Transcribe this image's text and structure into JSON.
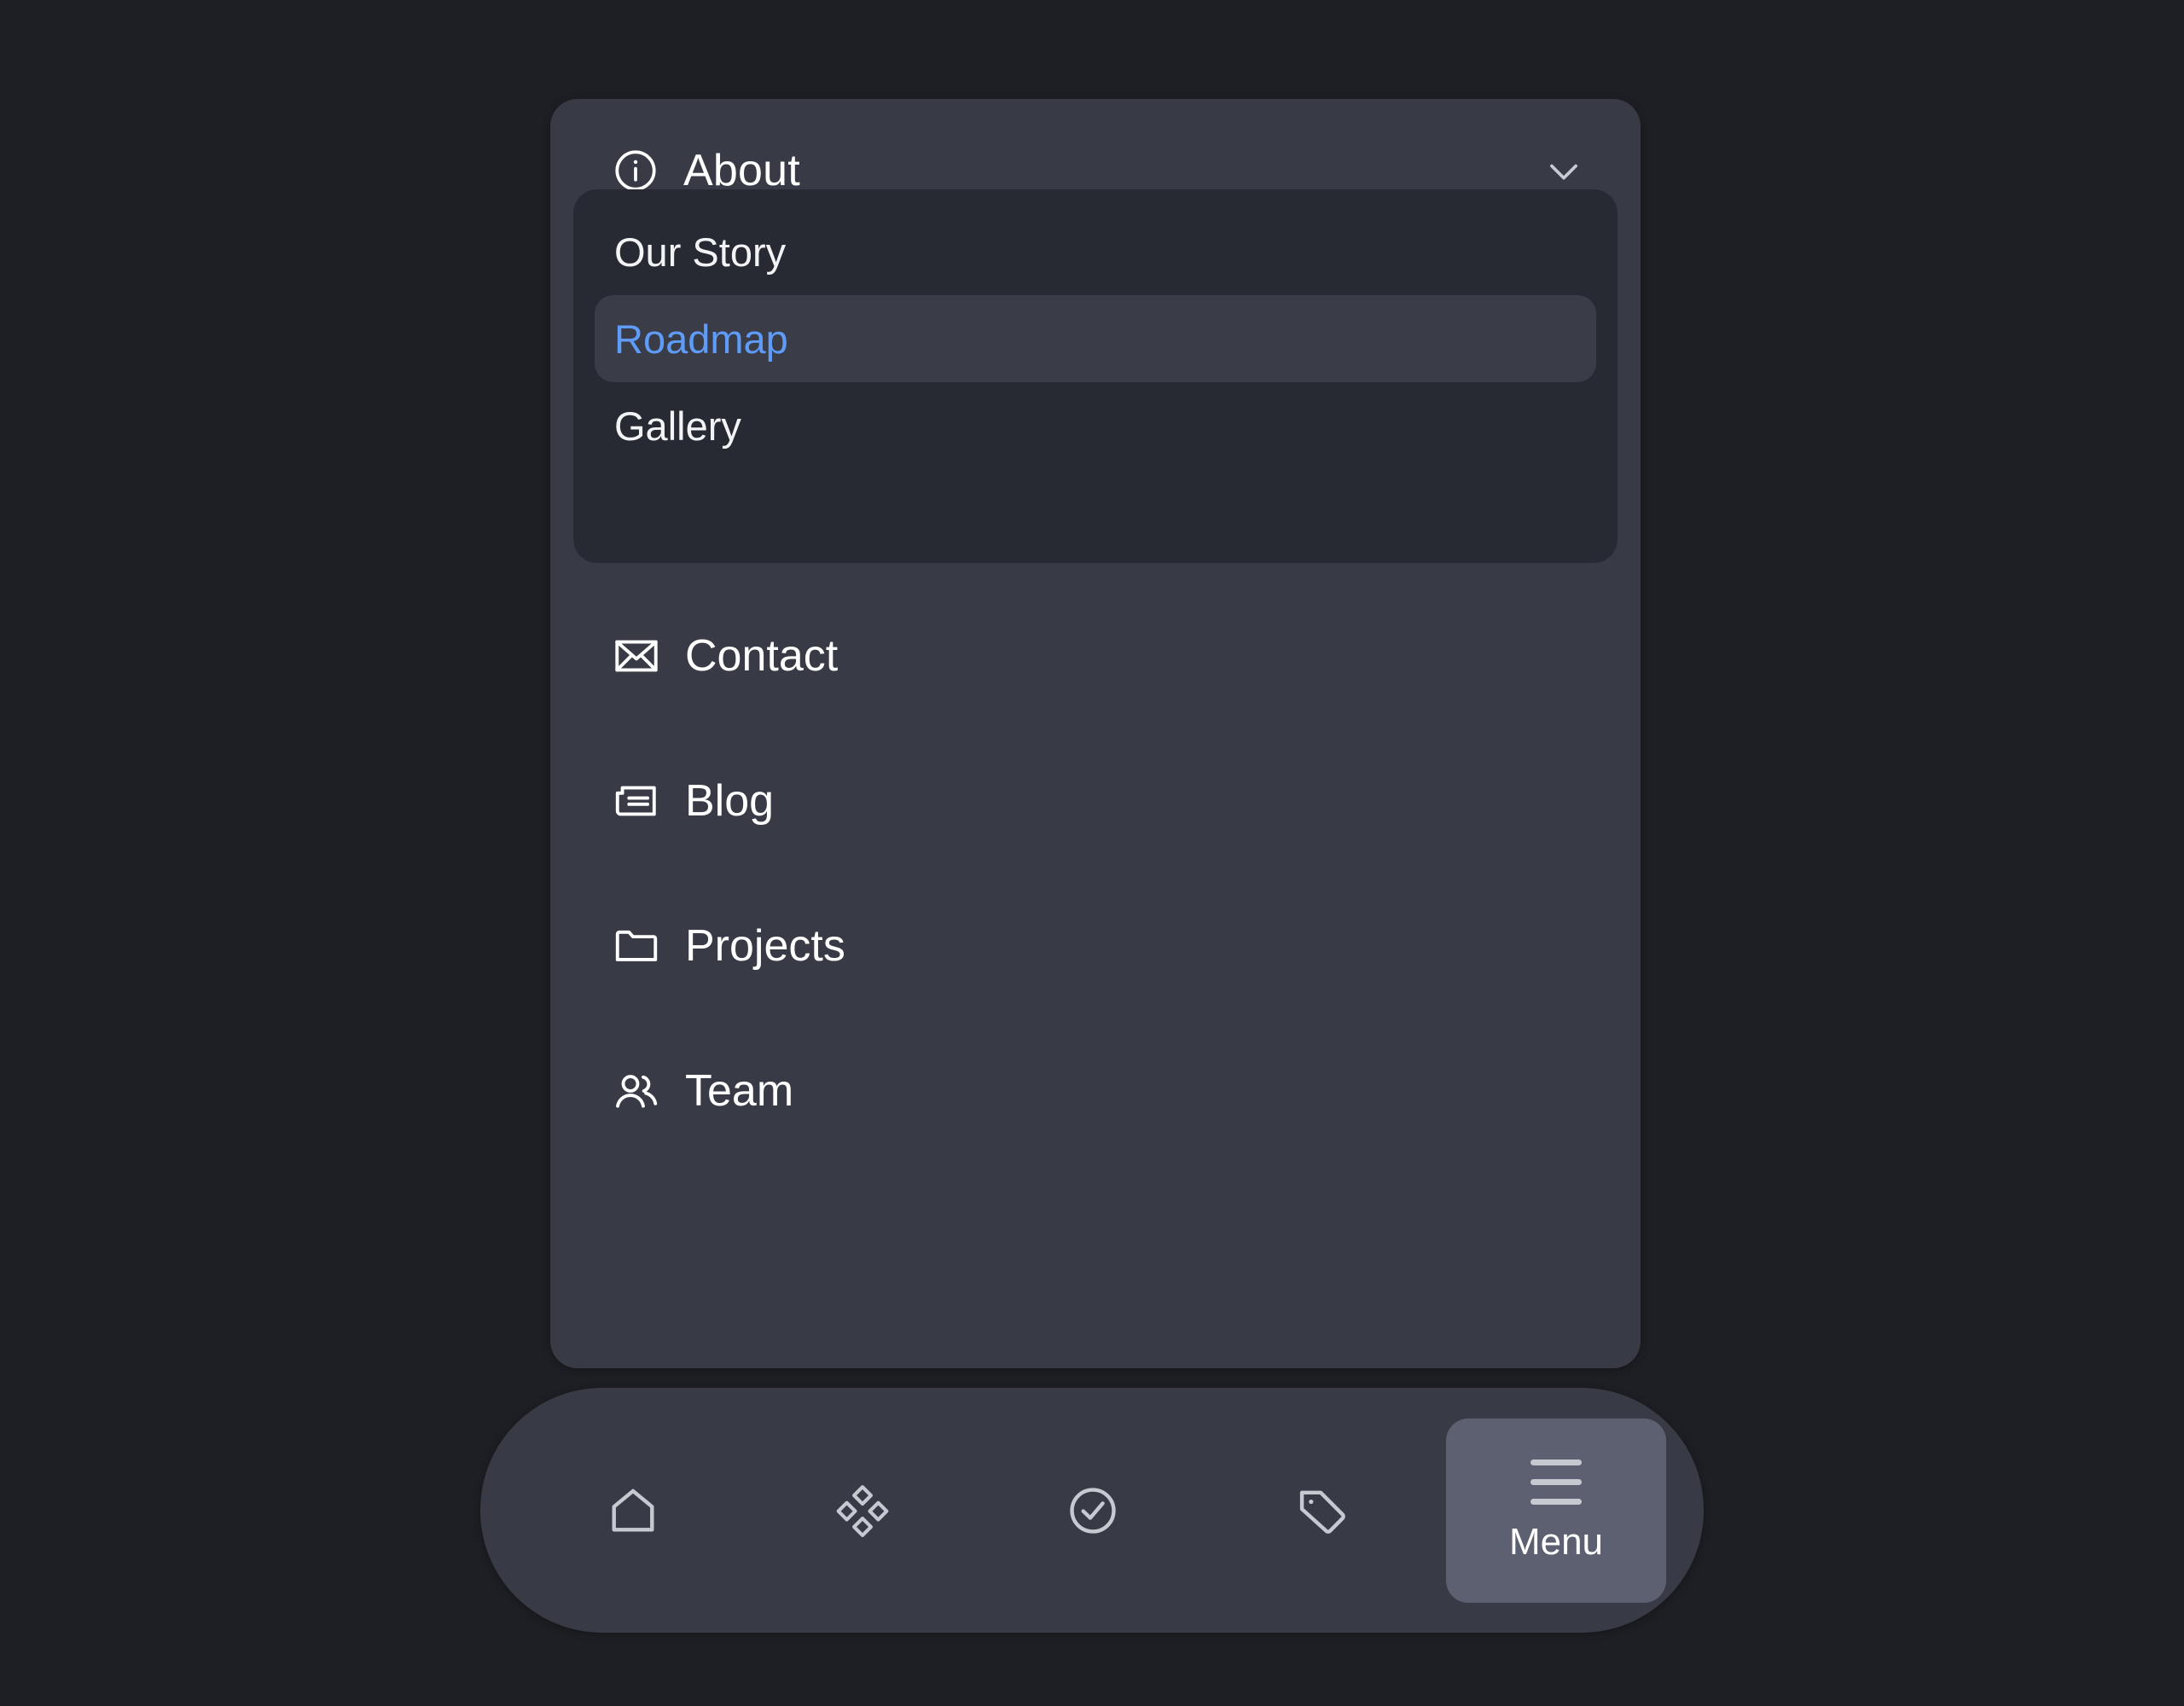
{
  "theme": {
    "page_background": "#1e1f24",
    "panel_background": "#383b45",
    "submenu_background": "#272a33",
    "active_item_background": "#3a3d47",
    "accent_blue": "#5f9bf8",
    "text_primary": "#ffffff",
    "icon_muted": "#c7c9d1",
    "menu_button_background": "#5d6070"
  },
  "menu_panel": {
    "header": {
      "icon": "info-circle-icon",
      "label": "About",
      "expand_icon": "chevron-down-icon",
      "expanded": true
    },
    "submenu": {
      "items": [
        {
          "label": "Our Story",
          "active": false
        },
        {
          "label": "Roadmap",
          "active": true
        },
        {
          "label": "Gallery",
          "active": false
        }
      ]
    },
    "nav_items": [
      {
        "label": "Contact",
        "icon": "envelope-icon"
      },
      {
        "label": "Blog",
        "icon": "newspaper-icon"
      },
      {
        "label": "Projects",
        "icon": "folder-icon"
      },
      {
        "label": "Team",
        "icon": "users-icon"
      }
    ]
  },
  "bottom_dock": {
    "items": [
      {
        "icon": "home-icon",
        "label": "",
        "active": false
      },
      {
        "icon": "apps-grid-icon",
        "label": "",
        "active": false
      },
      {
        "icon": "check-circle-icon",
        "label": "",
        "active": false
      },
      {
        "icon": "tag-icon",
        "label": "",
        "active": false
      },
      {
        "icon": "hamburger-icon",
        "label": "Menu",
        "active": true
      }
    ]
  }
}
